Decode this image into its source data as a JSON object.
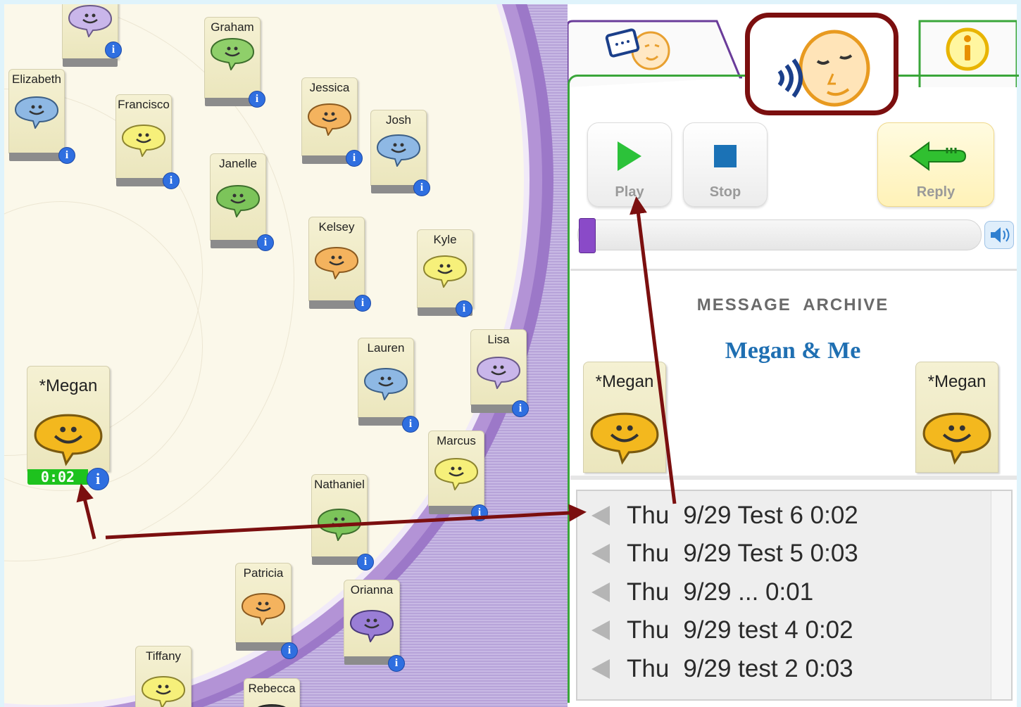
{
  "contacts": [
    {
      "name": "",
      "color": "#c9b6ea"
    },
    {
      "name": "Graham",
      "color": "#8fcf6a"
    },
    {
      "name": "Elizabeth",
      "color": "#8eb8e4"
    },
    {
      "name": "Francisco",
      "color": "#f6f07a"
    },
    {
      "name": "Jessica",
      "color": "#f4b35e"
    },
    {
      "name": "Josh",
      "color": "#8eb8e4"
    },
    {
      "name": "Janelle",
      "color": "#7cc45a"
    },
    {
      "name": "Kelsey",
      "color": "#f4b35e"
    },
    {
      "name": "Kyle",
      "color": "#f6f07a"
    },
    {
      "name": "Lauren",
      "color": "#8eb8e4"
    },
    {
      "name": "Lisa",
      "color": "#c9b6ea"
    },
    {
      "name": "Marcus",
      "color": "#f6f07a"
    },
    {
      "name": "Nathaniel",
      "color": "#7cc45a"
    },
    {
      "name": "Patricia",
      "color": "#f4b35e"
    },
    {
      "name": "Orianna",
      "color": "#9a7ed6"
    },
    {
      "name": "Tiffany",
      "color": "#f6f07a"
    },
    {
      "name": "Rebecca",
      "color": "#444444"
    }
  ],
  "active_contact": {
    "name": "*Megan",
    "timer": "0:02",
    "color": "#f3b81e"
  },
  "info_glyph": "i",
  "controls": {
    "play": "Play",
    "stop": "Stop",
    "reply": "Reply"
  },
  "archive": {
    "heading": "MESSAGE  ARCHIVE",
    "title": "Megan & Me",
    "left_card": "*Megan",
    "right_card": "*Megan"
  },
  "messages": [
    {
      "day": "Thu",
      "text": "9/29 Test 6 0:02"
    },
    {
      "day": "Thu",
      "text": "9/29 Test 5 0:03"
    },
    {
      "day": "Thu",
      "text": "9/29 ... 0:01"
    },
    {
      "day": "Thu",
      "text": "9/29 test 4 0:02"
    },
    {
      "day": "Thu",
      "text": "9/29 test 2 0:03"
    }
  ],
  "colors": {
    "accent_dark_red": "#7b0f0f",
    "tab_border": "#3aa63a",
    "play_green": "#2cc23a",
    "stop_blue": "#1b72b6",
    "timer_green": "#1ec21e"
  }
}
